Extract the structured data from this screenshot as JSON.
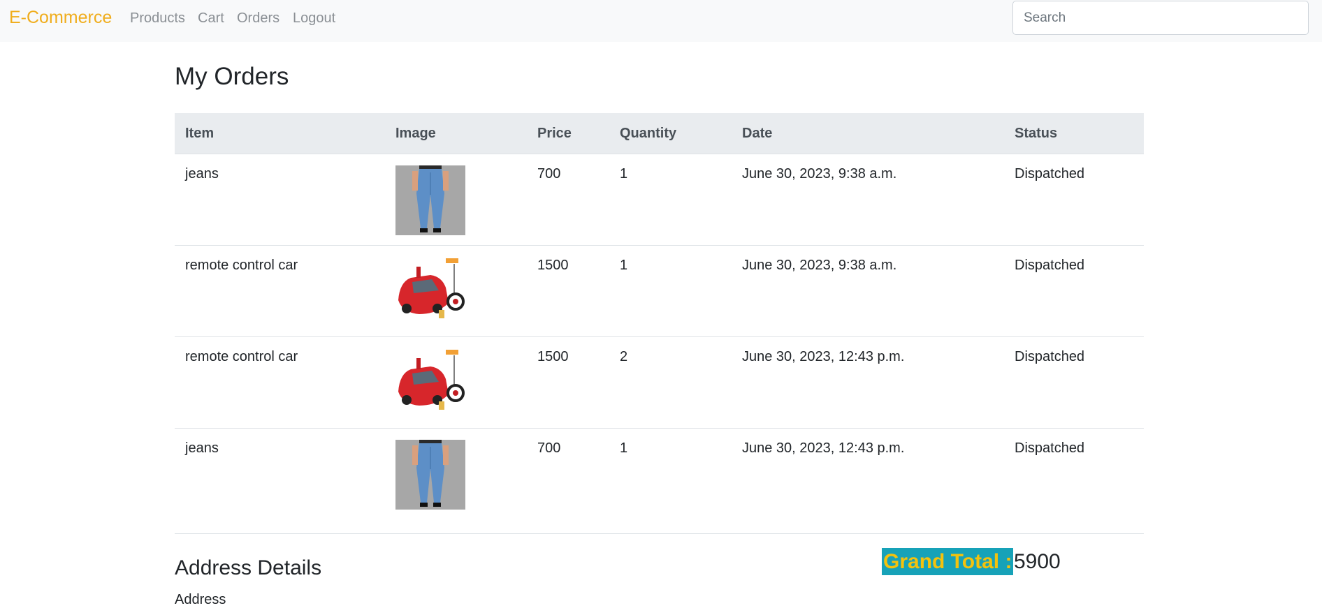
{
  "navbar": {
    "brand": "E-Commerce",
    "links": [
      "Products",
      "Cart",
      "Orders",
      "Logout"
    ],
    "search_placeholder": "Search",
    "brand_color": "#f0ad1c"
  },
  "page": {
    "title": "My Orders"
  },
  "table": {
    "headers": [
      "Item",
      "Image",
      "Price",
      "Quantity",
      "Date",
      "Status"
    ],
    "rows": [
      {
        "item": "jeans",
        "image": "jeans",
        "price": "700",
        "quantity": "1",
        "date": "June 30, 2023, 9:38 a.m.",
        "status": "Dispatched"
      },
      {
        "item": "remote control car",
        "image": "remote-control-car",
        "price": "1500",
        "quantity": "1",
        "date": "June 30, 2023, 9:38 a.m.",
        "status": "Dispatched"
      },
      {
        "item": "remote control car",
        "image": "remote-control-car",
        "price": "1500",
        "quantity": "2",
        "date": "June 30, 2023, 12:43 p.m.",
        "status": "Dispatched"
      },
      {
        "item": "jeans",
        "image": "jeans",
        "price": "700",
        "quantity": "1",
        "date": "June 30, 2023, 12:43 p.m.",
        "status": "Dispatched"
      }
    ]
  },
  "address": {
    "title": "Address Details",
    "label": "Address"
  },
  "grand_total": {
    "label": "Grand Total :",
    "value": "5900",
    "label_bg": "#17a2b8",
    "label_color": "#f4c20d"
  }
}
